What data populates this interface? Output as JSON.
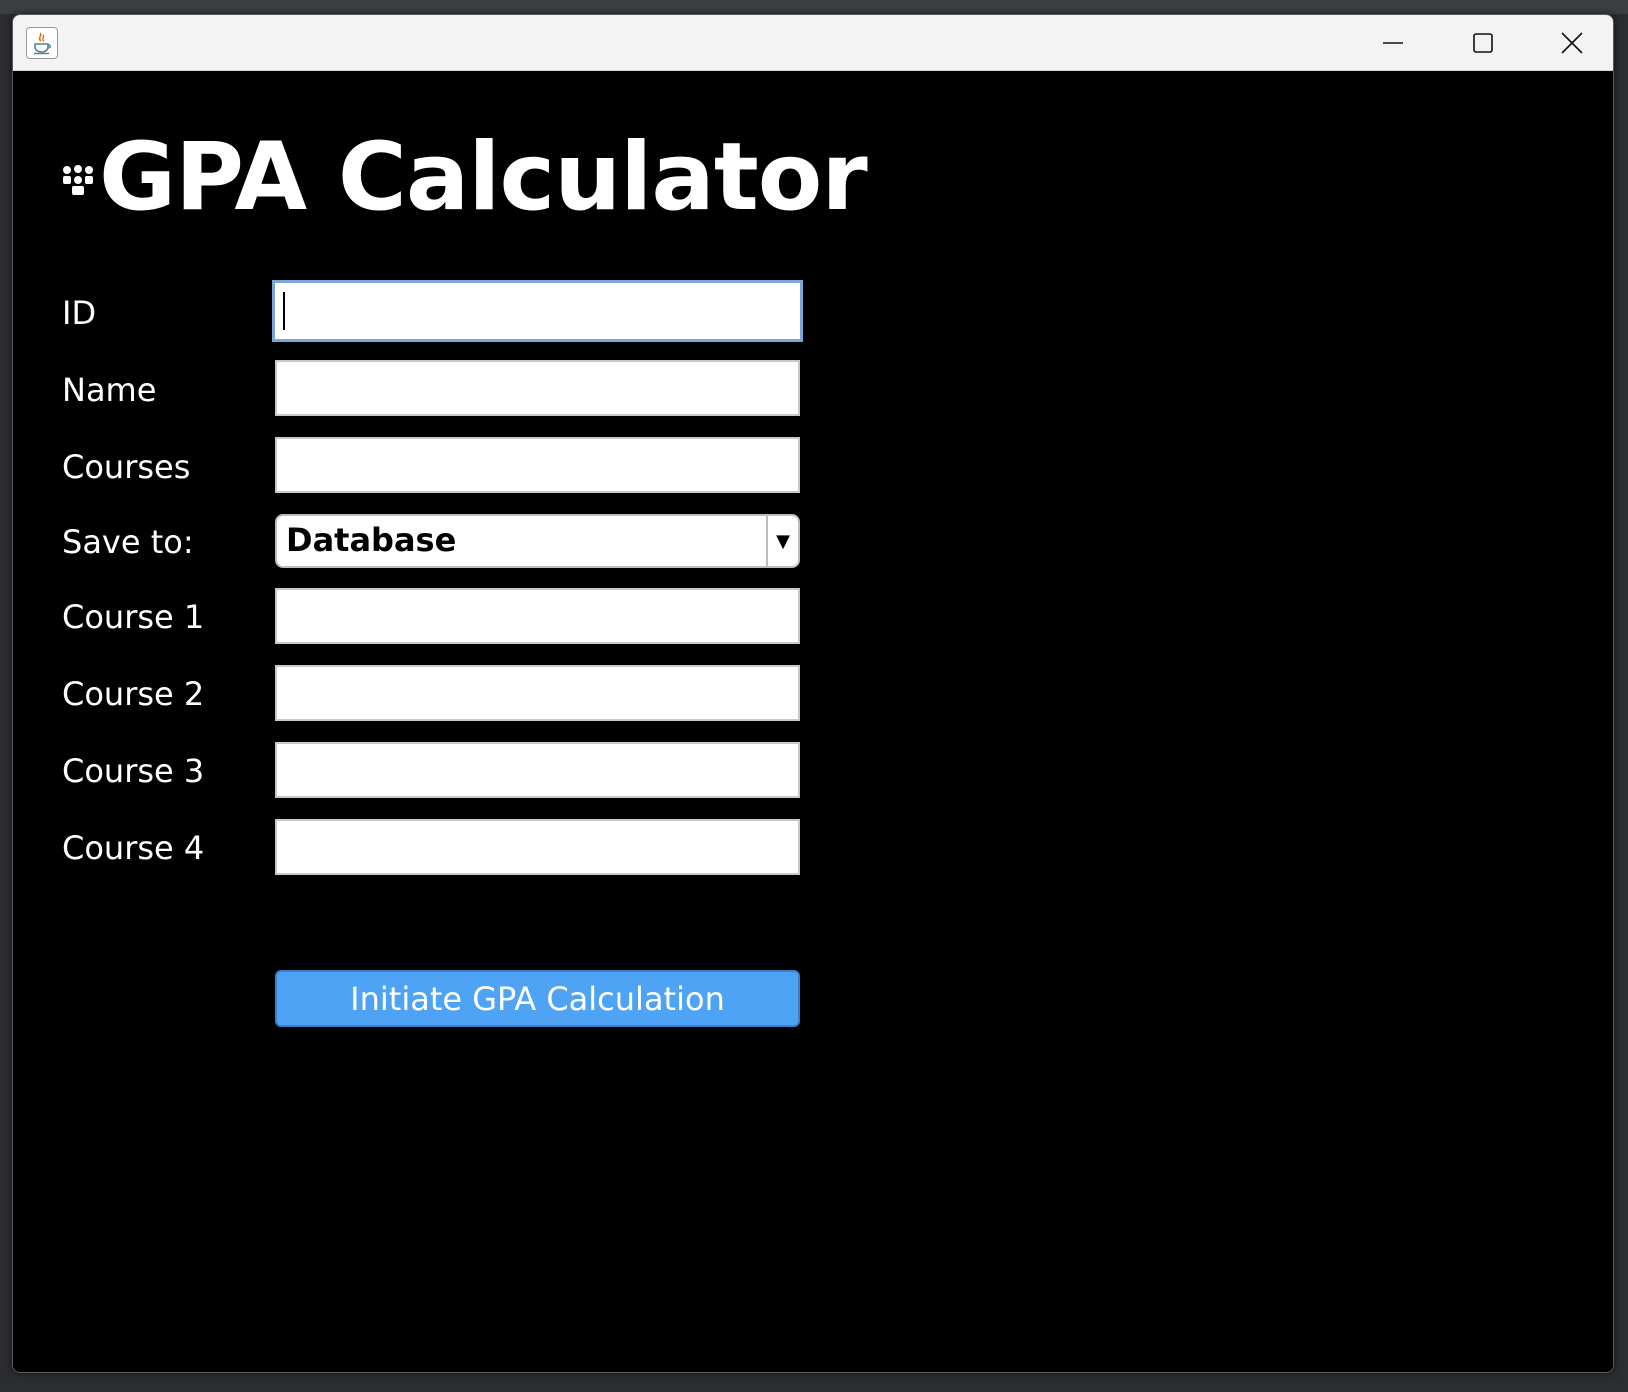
{
  "window": {
    "title": "",
    "controls": {
      "minimize_icon": "minimize-icon",
      "maximize_icon": "maximize-icon",
      "close_icon": "close-icon"
    }
  },
  "form": {
    "title": "GPA Calculator",
    "title_icon": "people-icon",
    "fields": {
      "id": {
        "label": "ID",
        "value": ""
      },
      "name": {
        "label": "Name",
        "value": ""
      },
      "courses": {
        "label": "Courses",
        "value": ""
      },
      "save_to": {
        "label": "Save to:",
        "selected": "Database"
      },
      "course1": {
        "label": "Course 1",
        "value": ""
      },
      "course2": {
        "label": "Course 2",
        "value": ""
      },
      "course3": {
        "label": "Course 3",
        "value": ""
      },
      "course4": {
        "label": "Course 4",
        "value": ""
      }
    },
    "submit_label": "Initiate GPA Calculation"
  },
  "colors": {
    "background": "#000000",
    "button": "#4ea3f5",
    "text": "#ffffff"
  }
}
